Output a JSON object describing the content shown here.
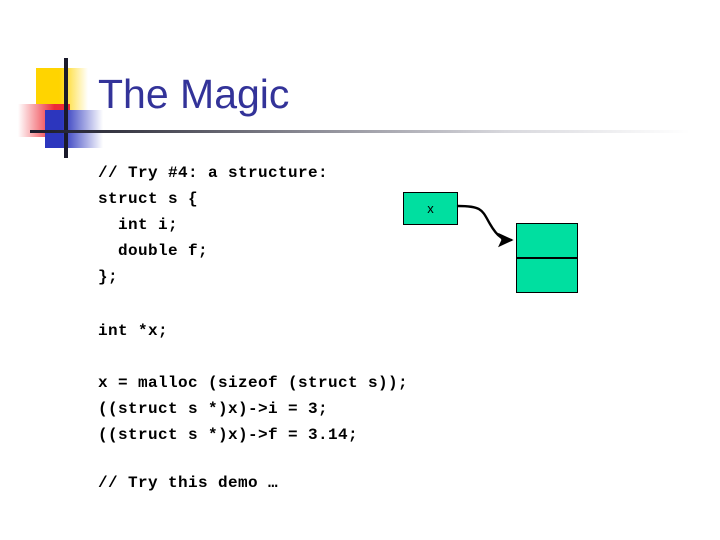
{
  "slide": {
    "title": "The Magic",
    "title_color": "#333399"
  },
  "logo": {
    "yellow_color": "#FFD400",
    "red_color": "#ED2A36",
    "blue_color": "#2C36BE",
    "bar_color": "#1a1a2a"
  },
  "code": {
    "struct_block": "// Try #4: a structure:\nstruct s {\n  int i;\n  double f;\n};",
    "decl_block": "int *x;",
    "body_block": "x = malloc (sizeof (struct s));\n((struct s *)x)->i = 3;\n((struct s *)x)->f = 3.14;",
    "demo_block": "// Try this demo …"
  },
  "diagram": {
    "pointer_label": "x",
    "box_fill": "#00DFA0",
    "box_border": "#000000",
    "heap_cells": 2
  }
}
